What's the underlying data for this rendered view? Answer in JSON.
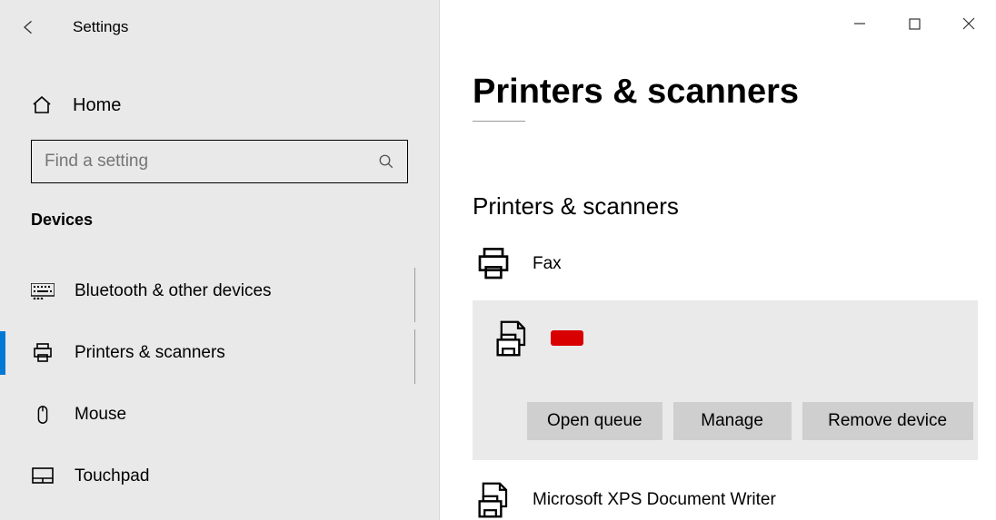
{
  "titlebar": {
    "title": "Settings"
  },
  "home": {
    "label": "Home"
  },
  "search": {
    "placeholder": "Find a setting"
  },
  "category": {
    "label": "Devices"
  },
  "nav": {
    "bluetooth": "Bluetooth & other devices",
    "printers": "Printers & scanners",
    "mouse": "Mouse",
    "touchpad": "Touchpad"
  },
  "page": {
    "title": "Printers & scanners",
    "section": "Printers & scanners"
  },
  "devices": {
    "fax": "Fax",
    "selected_name_redacted": true,
    "xps": "Microsoft XPS Document Writer"
  },
  "buttons": {
    "open_queue": "Open queue",
    "manage": "Manage",
    "remove": "Remove device"
  }
}
